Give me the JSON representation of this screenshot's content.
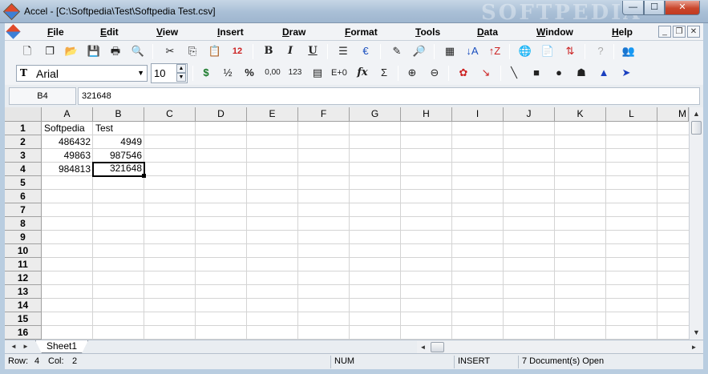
{
  "window": {
    "title": "Accel - [C:\\Softpedia\\Test\\Softpedia Test.csv]",
    "watermark": "SOFTPEDIA",
    "min_glyph": "—",
    "max_glyph": "☐",
    "close_glyph": "✕"
  },
  "menubar": {
    "items": [
      {
        "key": "F",
        "rest": "ile"
      },
      {
        "key": "E",
        "rest": "dit"
      },
      {
        "key": "V",
        "rest": "iew"
      },
      {
        "key": "I",
        "rest": "nsert"
      },
      {
        "key": "D",
        "rest": "raw"
      },
      {
        "key": "F",
        "rest": "ormat"
      },
      {
        "key": "T",
        "rest": "ools"
      },
      {
        "key": "D",
        "rest": "ata"
      },
      {
        "key": "W",
        "rest": "indow"
      },
      {
        "key": "H",
        "rest": "elp"
      }
    ],
    "mdi_min": "_",
    "mdi_restore": "❐",
    "mdi_close": "✕"
  },
  "toolbar1": {
    "bold": "B",
    "italic": "I",
    "underline": "U",
    "icons": [
      "new-document-icon",
      "copy-documents-icon",
      "open-folder-icon",
      "save-icon",
      "print-icon",
      "print-preview-icon",
      "cut-icon",
      "copy-icon",
      "paste-icon",
      "calendar-icon",
      "bold-icon",
      "italic-icon",
      "underline-icon",
      "align-icon",
      "euro-icon",
      "chart-wizard-icon",
      "find-icon",
      "table-icon",
      "sort-ascending-icon",
      "sort-descending-icon",
      "globe-icon",
      "clipboard-icon",
      "chart-icon",
      "help-icon",
      "users-icon"
    ]
  },
  "toolbar2": {
    "font_glyph": "T",
    "font_name": "Arial",
    "font_size": "10",
    "half": "½",
    "percent": "%",
    "decimals": "0,00",
    "numbers": "123",
    "exp": "E+0",
    "fx": "fx",
    "sum": "Σ"
  },
  "formula_bar": {
    "cell_ref": "B4",
    "content": "321648"
  },
  "grid": {
    "columns": [
      "A",
      "B",
      "C",
      "D",
      "E",
      "F",
      "G",
      "H",
      "I",
      "J",
      "K",
      "L",
      "M"
    ],
    "rows": [
      "1",
      "2",
      "3",
      "4",
      "5",
      "6",
      "7",
      "8",
      "9",
      "10",
      "11",
      "12",
      "13",
      "14",
      "15",
      "16"
    ],
    "cells": {
      "a1": "Softpedia",
      "b1": "Test",
      "a2": "486432",
      "b2": "4949",
      "a3": "49863",
      "b3": "987546",
      "a4": "984813",
      "b4": "321648"
    },
    "selected_cell": "B4"
  },
  "sheets": {
    "active": "Sheet1"
  },
  "statusbar": {
    "row_label": "Row:",
    "row_value": "4",
    "col_label": "Col:",
    "col_value": "2",
    "num": "NUM",
    "insert": "INSERT",
    "documents": "7 Document(s) Open"
  }
}
